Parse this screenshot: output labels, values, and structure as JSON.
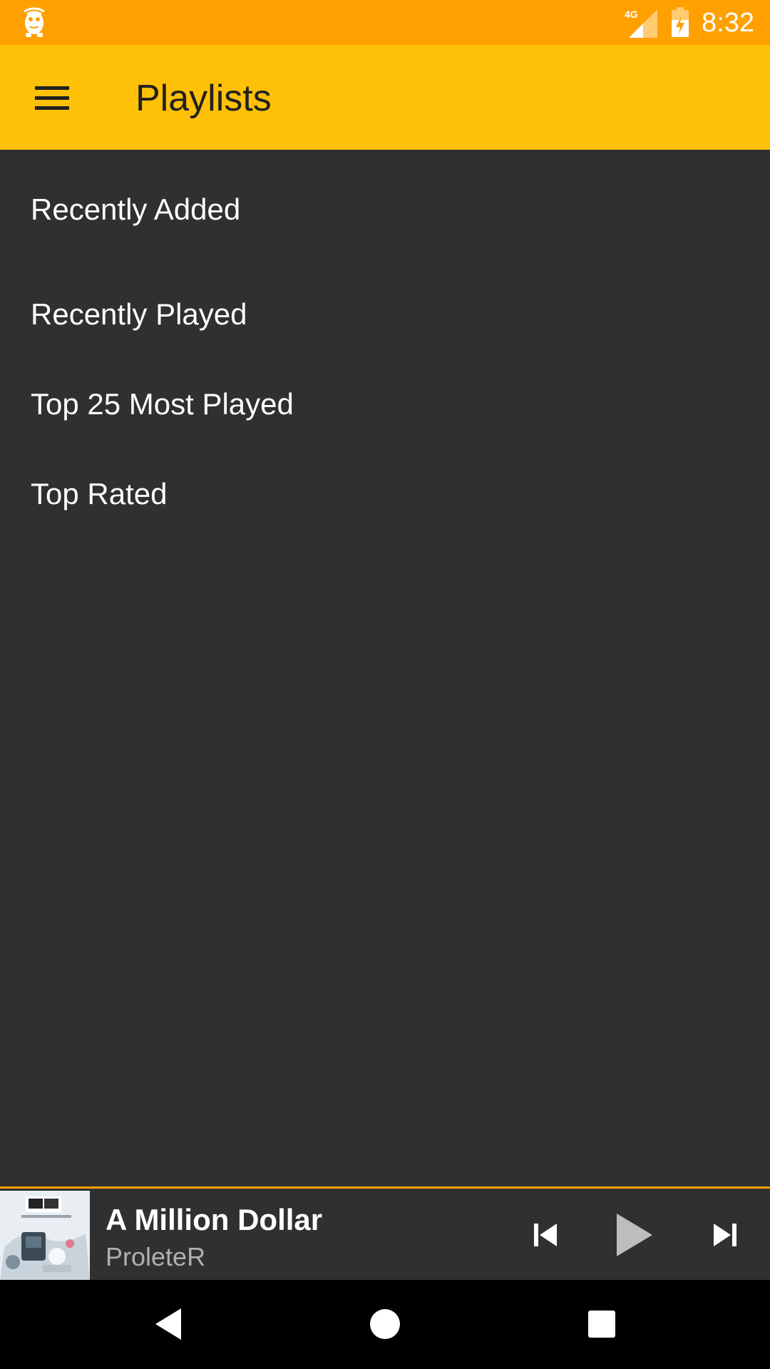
{
  "status_bar": {
    "time": "8:32",
    "network_label": "4G",
    "icons": [
      "app-notification-icon",
      "signal-icon",
      "battery-icon"
    ],
    "background": "#FFA000"
  },
  "app_bar": {
    "title": "Playlists",
    "menu_icon": "menu-icon",
    "background": "#FFC107"
  },
  "playlists": [
    {
      "label": "Recently Added"
    },
    {
      "label": "Recently Played"
    },
    {
      "label": "Top 25 Most Played"
    },
    {
      "label": "Top Rated"
    }
  ],
  "now_playing": {
    "title": "A Million Dollar",
    "artist": "ProleteR",
    "accent": "#FFA000",
    "controls": [
      "skip-previous-icon",
      "play-icon",
      "skip-next-icon"
    ]
  },
  "nav_bar": {
    "buttons": [
      "back-icon",
      "home-icon",
      "recents-icon"
    ]
  },
  "colors": {
    "background": "#303030",
    "text_primary": "#FFFFFF",
    "text_secondary": "#B0B0B0"
  }
}
